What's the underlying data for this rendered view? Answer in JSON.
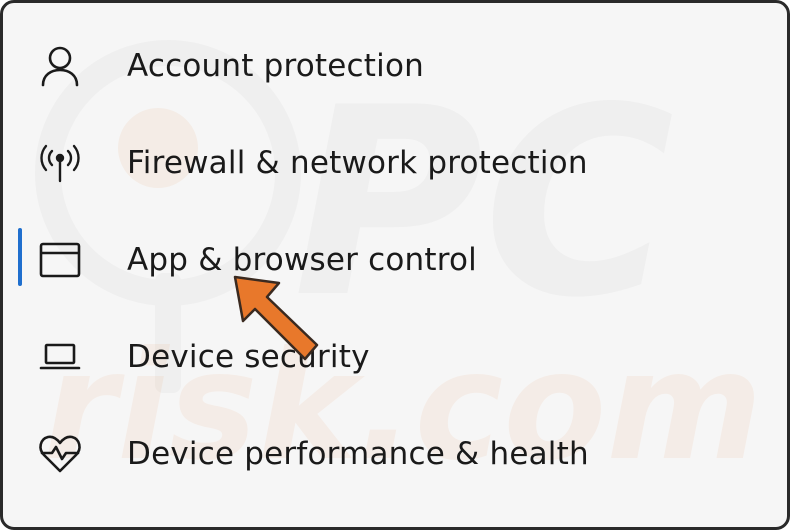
{
  "menu": {
    "items": [
      {
        "label": "Account protection",
        "icon": "person-icon"
      },
      {
        "label": "Firewall & network protection",
        "icon": "antenna-icon"
      },
      {
        "label": "App & browser control",
        "icon": "app-window-icon",
        "selected": true
      },
      {
        "label": "Device security",
        "icon": "laptop-icon"
      },
      {
        "label": "Device performance & health",
        "icon": "heart-pulse-icon"
      }
    ]
  },
  "watermark": {
    "text_top": "PC",
    "text_bottom": "risk.com"
  },
  "colors": {
    "accent": "#1f6fce",
    "arrow": "#e8782b",
    "text": "#1a1a1a",
    "background": "#f6f6f6"
  }
}
